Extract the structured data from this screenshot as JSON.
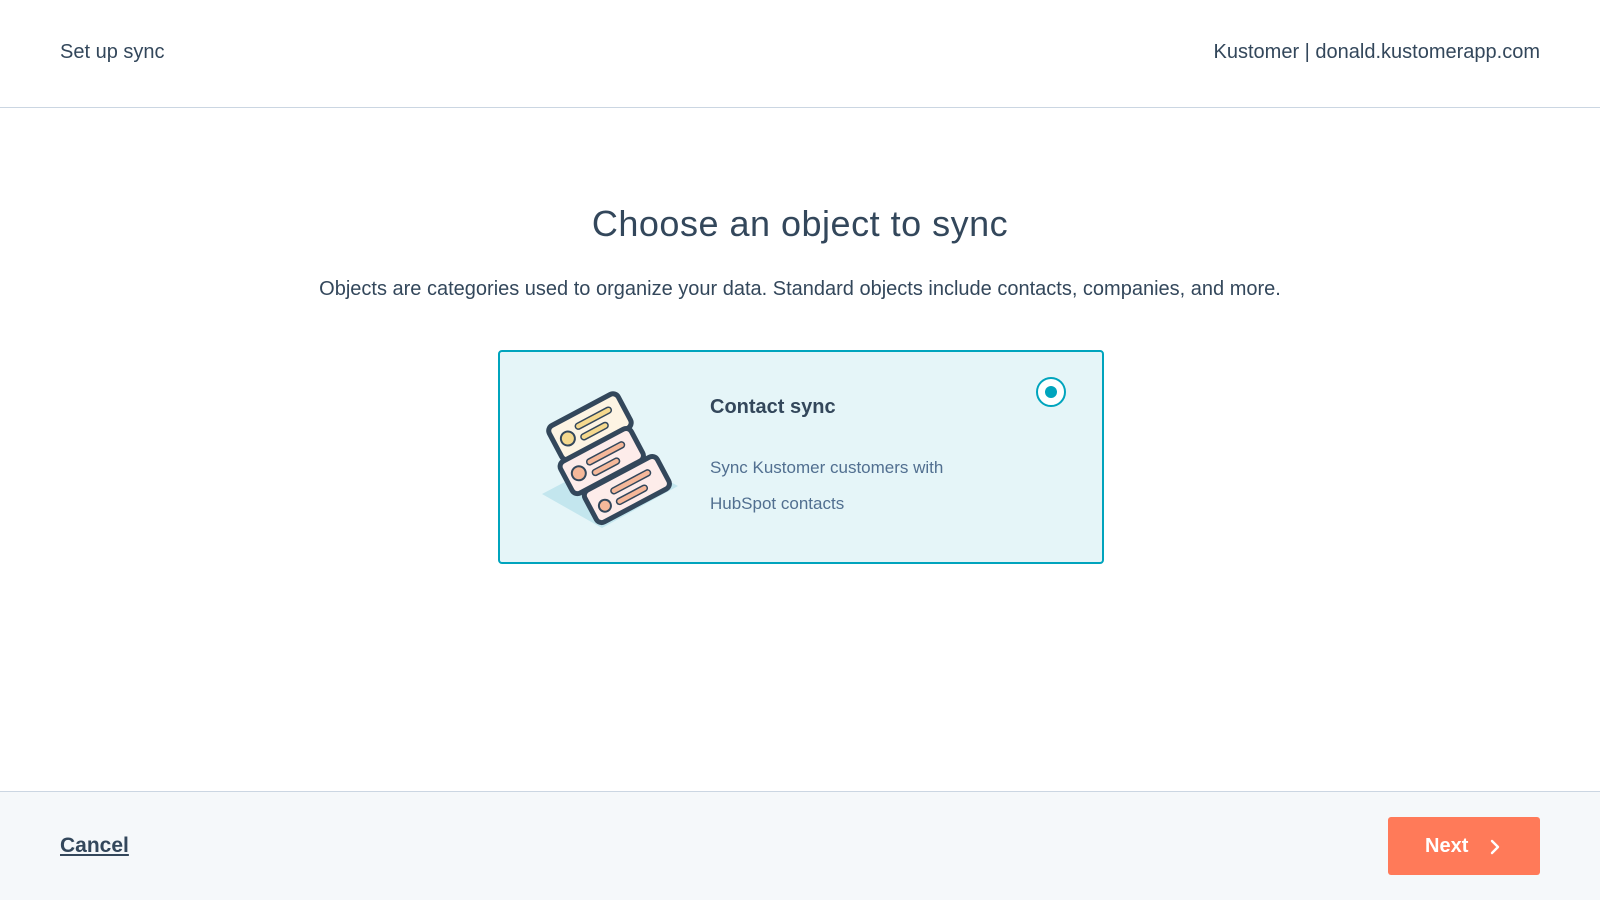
{
  "header": {
    "title": "Set up sync",
    "account": "Kustomer | donald.kustomerapp.com"
  },
  "main": {
    "heading": "Choose an object to sync",
    "subheading": "Objects are categories used to organize your data. Standard objects include contacts, companies, and more.",
    "options": [
      {
        "title": "Contact sync",
        "description": "Sync Kustomer customers with HubSpot contacts",
        "selected": true,
        "icon": "contact-cards-illustration"
      }
    ]
  },
  "footer": {
    "cancel_label": "Cancel",
    "next_label": "Next",
    "next_icon": "chevron-right-icon"
  },
  "colors": {
    "accent": "#00a4bd",
    "selected_card_bg": "#e5f5f8",
    "primary_button": "#ff7a59",
    "text": "#33475b",
    "footer_bg": "#f5f8fa"
  }
}
